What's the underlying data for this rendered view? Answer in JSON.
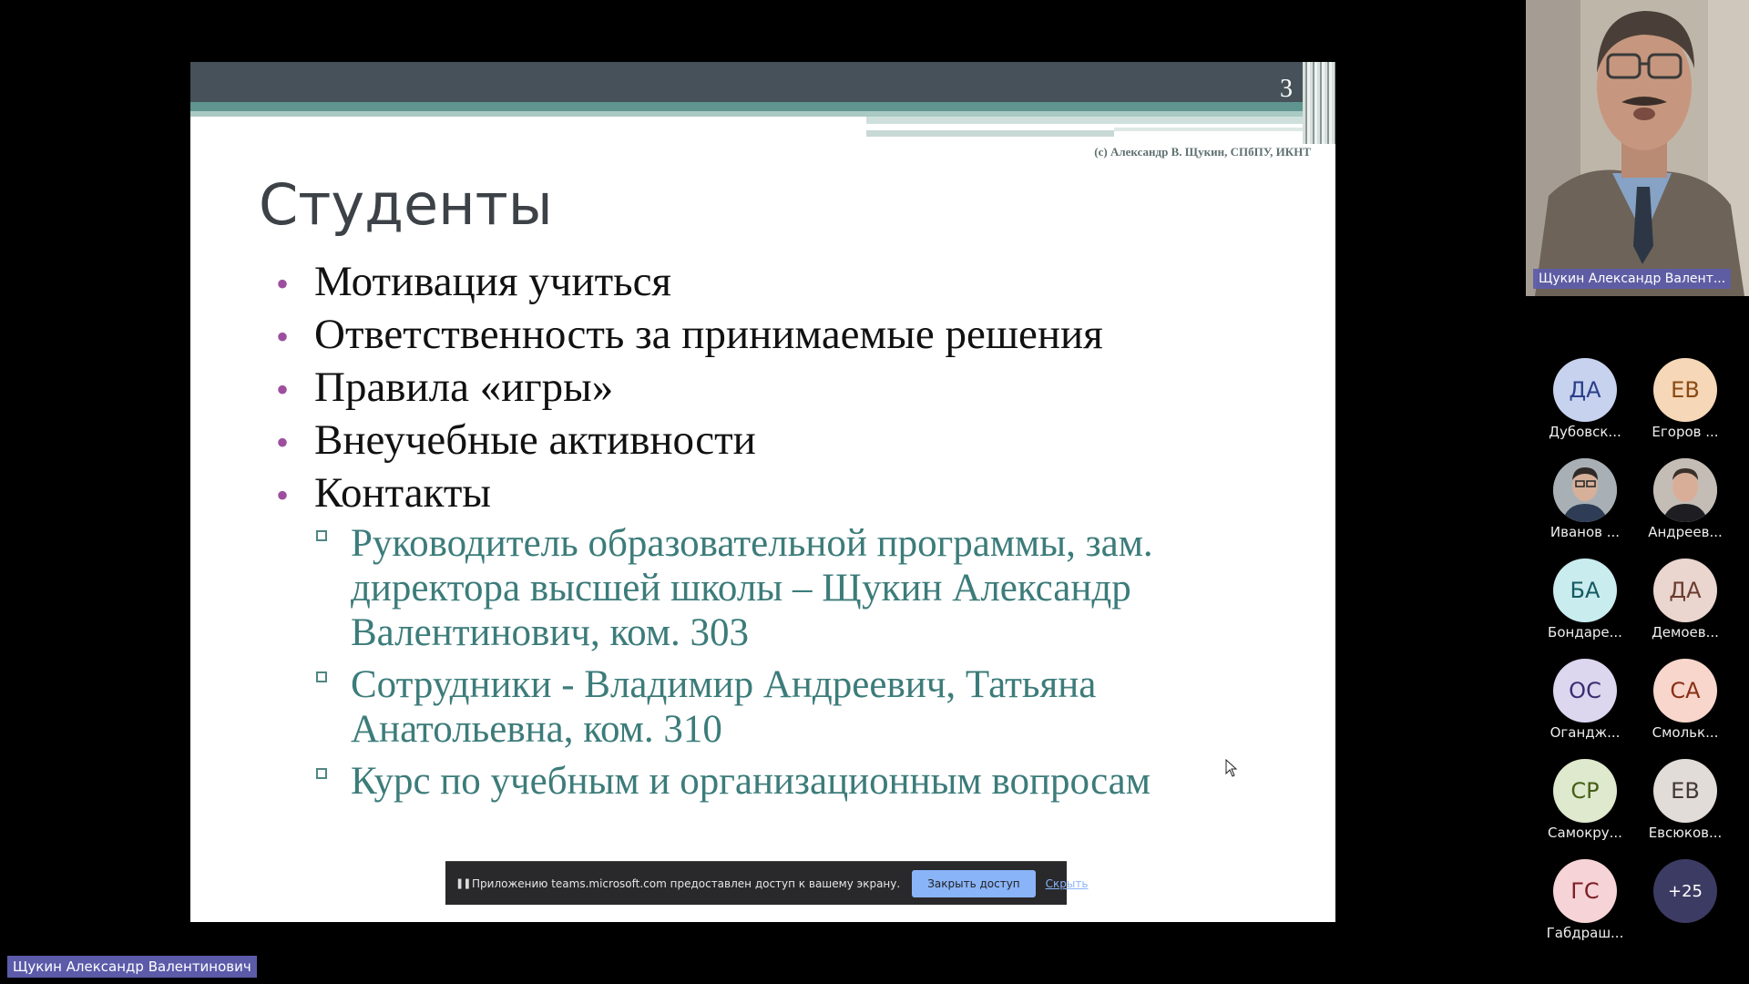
{
  "slide": {
    "page_number": "3",
    "copyright": "(c) Александр В. Щукин, СПбПУ, ИКНТ",
    "title": "Студенты",
    "bullets": [
      {
        "text": "Мотивация учиться"
      },
      {
        "text": "Ответственность за принимаемые решения"
      },
      {
        "text": "Правила «игры»"
      },
      {
        "text": "Внеучебные активности"
      },
      {
        "text": "Контакты"
      }
    ],
    "sub_bullets": [
      "Руководитель образовательной программы, зам. директора высшей школы – Щукин Александр Валентинович, ком. 303",
      "Сотрудники - Владимир Андреевич, Татьяна Анатольевна, ком. 310",
      "Курс по учебным и организационным вопросам"
    ],
    "bullet_color": "#9d4f9d",
    "sub_color": "#3c7c7a"
  },
  "share_bar": {
    "text": "Приложению teams.microsoft.com предоставлен доступ к вашему экрану.",
    "stop_button": "Закрыть доступ",
    "hide_link": "Скрыть"
  },
  "presenter": {
    "name": "Щукин Александр Валент..."
  },
  "participants": [
    {
      "initials": "ДА",
      "name": "Дубовск...",
      "bg": "#c7d2ef",
      "fg": "#2b3f8a"
    },
    {
      "initials": "ЕВ",
      "name": "Егоров ...",
      "bg": "#f6d7b7",
      "fg": "#8a4a13"
    },
    {
      "initials": "",
      "name": "Иванов ...",
      "bg": "#9aa3a9",
      "fg": "#ffffff"
    },
    {
      "initials": "",
      "name": "Андреев...",
      "bg": "#b2aba6",
      "fg": "#ffffff"
    },
    {
      "initials": "БА",
      "name": "Бондаре...",
      "bg": "#c9ecef",
      "fg": "#135a61"
    },
    {
      "initials": "ДА",
      "name": "Демоев...",
      "bg": "#ead5cf",
      "fg": "#6b3b2e"
    },
    {
      "initials": "ОС",
      "name": "Огандж...",
      "bg": "#dcd6ef",
      "fg": "#392e72"
    },
    {
      "initials": "СА",
      "name": "Смольк...",
      "bg": "#f8d6cc",
      "fg": "#8a2f15"
    },
    {
      "initials": "СР",
      "name": "Самокру...",
      "bg": "#dfe9cd",
      "fg": "#445f17"
    },
    {
      "initials": "ЕВ",
      "name": "Евсюков...",
      "bg": "#e2dcd8",
      "fg": "#433835"
    },
    {
      "initials": "ГС",
      "name": "Габдраш...",
      "bg": "#f6d3d6",
      "fg": "#7b1d26"
    },
    {
      "initials": "+25",
      "name": "",
      "bg": "#3b3b63",
      "fg": "#ffffff"
    }
  ],
  "name_tag": "Щукин Александр Валентинович"
}
